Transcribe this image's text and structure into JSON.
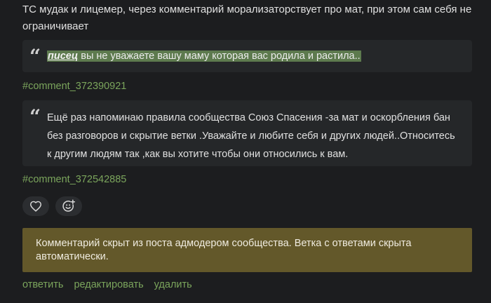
{
  "post": {
    "intro_text": "ТС мудак и лицемер, через комментарий морализаторствует про мат, при этом сам себя не ограничивает"
  },
  "quotes": [
    {
      "highlight_name": "писец",
      "highlight_text": " вы не уважаете вашу маму которая вас родила и растила..",
      "link": "#comment_372390921"
    },
    {
      "text": "Ещё раз напоминаю правила сообщества Союз Спасения -за мат и оскорбления бан без разговоров и скрытие ветки .Уважайте и любите себя и других людей..Относитесь к другим людям так ,как вы хотите чтобы они относились к вам.",
      "link": "#comment_372542885"
    }
  ],
  "icons": {
    "like": "heart-icon",
    "reaction": "smiley-plus-icon"
  },
  "notice": {
    "text": "Комментарий скрыт из поста адмодером сообщества. Ветка с ответами скрыта автоматически."
  },
  "actions": {
    "reply": "ответить",
    "edit": "редактировать",
    "delete": "удалить"
  },
  "colors": {
    "background": "#1c1d1f",
    "quote_background": "#252729",
    "link": "#7ba55c",
    "highlight": "#5d7a4e",
    "notice_background": "#63582a"
  }
}
